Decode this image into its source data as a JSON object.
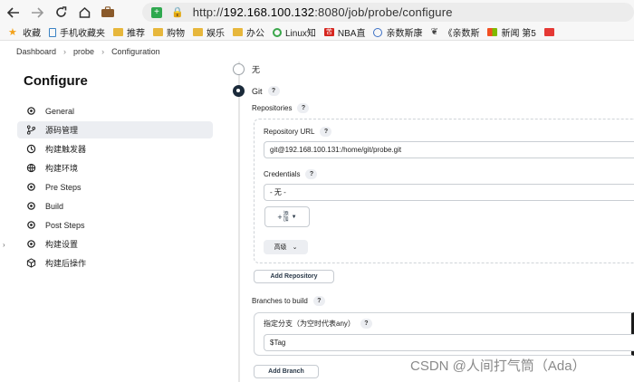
{
  "browser": {
    "url_prefix": "http://",
    "url_host": "192.168.100.132",
    "url_rest": ":8080/job/probe/configure",
    "bookmarks": [
      {
        "label": "收藏",
        "icon": "star-icon"
      },
      {
        "label": "手机收藏夹",
        "icon": "phone-icon"
      },
      {
        "label": "推荐",
        "icon": "folder-icon"
      },
      {
        "label": "购物",
        "icon": "folder-icon"
      },
      {
        "label": "娱乐",
        "icon": "folder-icon"
      },
      {
        "label": "办公",
        "icon": "folder-icon"
      },
      {
        "label": "Linux知",
        "icon": "circle-icon"
      },
      {
        "label": "NBA直",
        "icon": "nba-icon"
      },
      {
        "label": "亲数斯康",
        "icon": "globe-icon"
      },
      {
        "label": "《亲数斯",
        "icon": "book-icon"
      },
      {
        "label": "新闻 第5",
        "icon": "ms-icon"
      }
    ]
  },
  "breadcrumb": [
    "Dashboard",
    "probe",
    "Configuration"
  ],
  "sidebar": {
    "title": "Configure",
    "items": [
      {
        "label": "General",
        "icon": "gear-icon"
      },
      {
        "label": "源码管理",
        "icon": "branch-icon",
        "active": true
      },
      {
        "label": "构建触发器",
        "icon": "clock-icon"
      },
      {
        "label": "构建环境",
        "icon": "globe-icon"
      },
      {
        "label": "Pre Steps",
        "icon": "gear-icon"
      },
      {
        "label": "Build",
        "icon": "gear-icon"
      },
      {
        "label": "Post Steps",
        "icon": "gear-icon"
      },
      {
        "label": "构建设置",
        "icon": "gear-icon"
      },
      {
        "label": "构建后操作",
        "icon": "cube-icon"
      }
    ]
  },
  "scm": {
    "option_none": "无",
    "option_git": "Git",
    "selected": "Git",
    "repositories_label": "Repositories",
    "repo_url_label": "Repository URL",
    "repo_url_value": "git@192.168.100.131:/home/git/probe.git",
    "credentials_label": "Credentials",
    "credentials_value": "- 无 -",
    "add_button": "添\n加",
    "advanced_button": "高级",
    "add_repository_button": "Add Repository",
    "branches_label": "Branches to build",
    "branch_specifier_label": "指定分支（为空时代表any）",
    "branch_value": "$Tag",
    "add_branch_button": "Add Branch",
    "help_mark": "?"
  },
  "watermark": "CSDN @人间打气筒（Ada）"
}
